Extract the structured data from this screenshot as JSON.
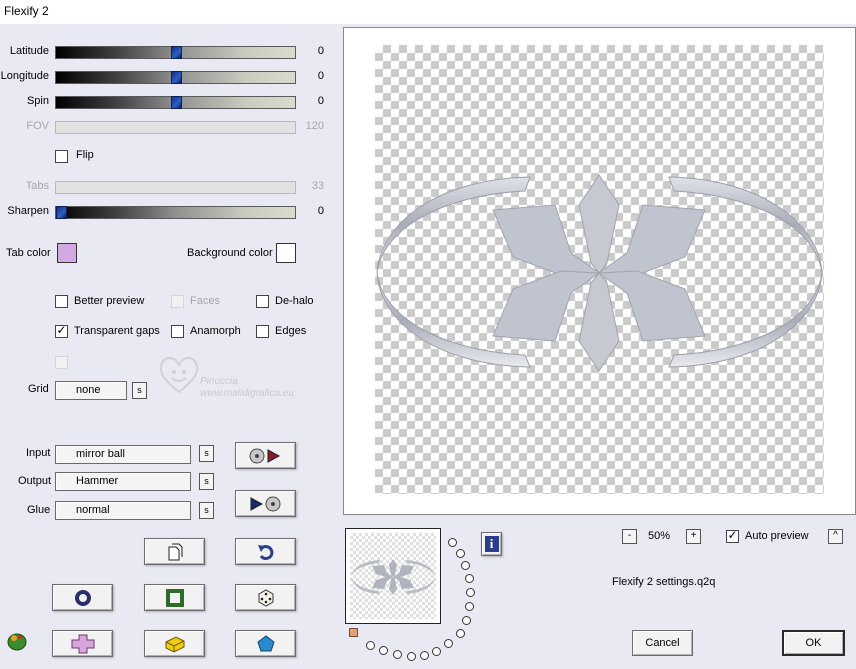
{
  "window": {
    "title": "Flexify 2"
  },
  "sliders": [
    {
      "label": "Latitude",
      "value": "0",
      "level": 0.5,
      "disabled": false
    },
    {
      "label": "Longitude",
      "value": "0",
      "level": 0.5,
      "disabled": false
    },
    {
      "label": "Spin",
      "value": "0",
      "level": 0.5,
      "disabled": false
    },
    {
      "label": "FOV",
      "value": "120",
      "disabled": true
    },
    {
      "label": "Tabs",
      "value": "33",
      "disabled": true
    },
    {
      "label": "Sharpen",
      "value": "0",
      "level": 0.0,
      "disabled": false
    }
  ],
  "flip": {
    "label": "Flip",
    "checked": false
  },
  "tab_color": {
    "label": "Tab color",
    "color": "#d4a8e0"
  },
  "background_color": {
    "label": "Background color",
    "color": "#ffffff"
  },
  "options": {
    "better_preview": {
      "label": "Better preview",
      "checked": false
    },
    "faces": {
      "label": "Faces",
      "checked": false,
      "disabled": true
    },
    "de_halo": {
      "label": "De-halo",
      "checked": false
    },
    "transparent_gaps": {
      "label": "Transparent gaps",
      "checked": true
    },
    "anamorph": {
      "label": "Anamorph",
      "checked": false
    },
    "edges": {
      "label": "Edges",
      "checked": false
    }
  },
  "grid": {
    "label": "Grid",
    "value": "none",
    "s": "s"
  },
  "input": {
    "label": "Input",
    "value": "mirror ball",
    "s": "s"
  },
  "output": {
    "label": "Output",
    "value": "Hammer",
    "s": "s"
  },
  "glue": {
    "label": "Glue",
    "value": "normal",
    "s": "s"
  },
  "watermark": {
    "line1": "Pinuccia",
    "line2": "www.maildigrafica.eu"
  },
  "zoom": {
    "minus": "-",
    "value": "50%",
    "plus": "+"
  },
  "auto_preview": {
    "label": "Auto preview",
    "checked": true,
    "caret": "^"
  },
  "settings_file": "Flexify 2 settings.q2q",
  "info_label": "i",
  "buttons": {
    "cancel": "Cancel",
    "ok": "OK"
  }
}
